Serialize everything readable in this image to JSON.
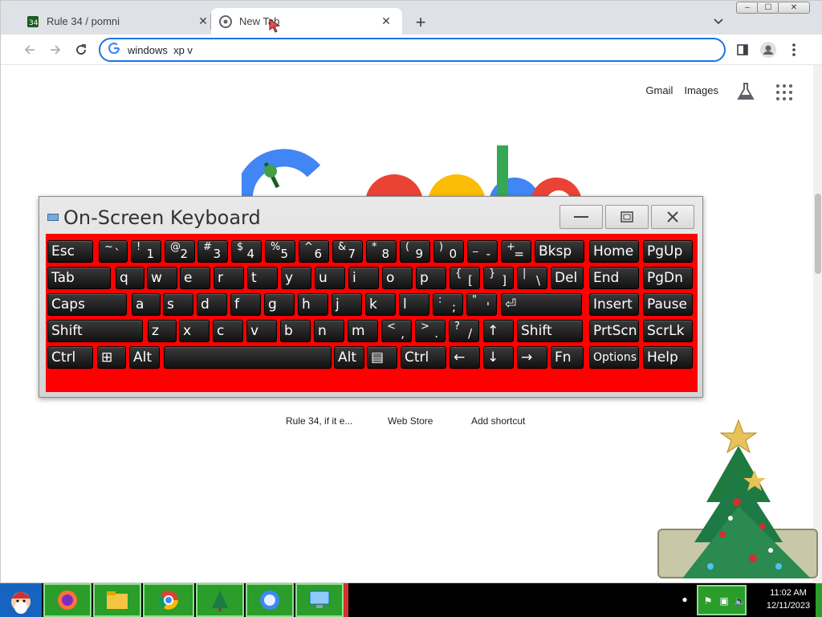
{
  "browser": {
    "tabs": [
      {
        "title": "Rule 34 / pomni",
        "active": false
      },
      {
        "title": "New Tab",
        "active": true
      }
    ],
    "omnibox_text": "windows  xp v",
    "window_controls": [
      "–",
      "☐",
      "✕"
    ]
  },
  "ntp": {
    "links": {
      "gmail": "Gmail",
      "images": "Images"
    },
    "doodle_text": "Google",
    "shortcuts": [
      "Rule 34, if it e...",
      "Web Store",
      "Add shortcut"
    ]
  },
  "osk": {
    "title": "On-Screen Keyboard",
    "rows": [
      [
        {
          "main": "Esc"
        },
        {
          "shift": "~",
          "base": "`"
        },
        {
          "shift": "!",
          "base": "1"
        },
        {
          "shift": "@",
          "base": "2"
        },
        {
          "shift": "#",
          "base": "3"
        },
        {
          "shift": "$",
          "base": "4"
        },
        {
          "shift": "%",
          "base": "5"
        },
        {
          "shift": "^",
          "base": "6"
        },
        {
          "shift": "&",
          "base": "7"
        },
        {
          "shift": "*",
          "base": "8"
        },
        {
          "shift": "(",
          "base": "9"
        },
        {
          "shift": ")",
          "base": "0"
        },
        {
          "shift": "_",
          "base": "-"
        },
        {
          "shift": "+",
          "base": "="
        },
        {
          "main": "Bksp"
        },
        {
          "main": "Home"
        },
        {
          "main": "PgUp"
        }
      ],
      [
        {
          "main": "Tab"
        },
        {
          "main": "q"
        },
        {
          "main": "w"
        },
        {
          "main": "e"
        },
        {
          "main": "r"
        },
        {
          "main": "t"
        },
        {
          "main": "y"
        },
        {
          "main": "u"
        },
        {
          "main": "i"
        },
        {
          "main": "o"
        },
        {
          "main": "p"
        },
        {
          "shift": "{",
          "base": "["
        },
        {
          "shift": "}",
          "base": "]"
        },
        {
          "shift": "|",
          "base": "\\"
        },
        {
          "main": "Del"
        },
        {
          "main": "End"
        },
        {
          "main": "PgDn"
        }
      ],
      [
        {
          "main": "Caps"
        },
        {
          "main": "a"
        },
        {
          "main": "s"
        },
        {
          "main": "d"
        },
        {
          "main": "f"
        },
        {
          "main": "g"
        },
        {
          "main": "h"
        },
        {
          "main": "j"
        },
        {
          "main": "k"
        },
        {
          "main": "l"
        },
        {
          "shift": ":",
          "base": ";"
        },
        {
          "shift": "\"",
          "base": "'"
        },
        {
          "main": "⏎"
        },
        {
          "main": "Insert"
        },
        {
          "main": "Pause"
        }
      ],
      [
        {
          "main": "Shift"
        },
        {
          "main": "z"
        },
        {
          "main": "x"
        },
        {
          "main": "c"
        },
        {
          "main": "v"
        },
        {
          "main": "b"
        },
        {
          "main": "n"
        },
        {
          "main": "m"
        },
        {
          "shift": "<",
          "base": ","
        },
        {
          "shift": ">",
          "base": "."
        },
        {
          "shift": "?",
          "base": "/"
        },
        {
          "main": "↑"
        },
        {
          "main": "Shift"
        },
        {
          "main": "PrtScn"
        },
        {
          "main": "ScrLk"
        }
      ],
      [
        {
          "main": "Ctrl"
        },
        {
          "main": "⊞"
        },
        {
          "main": "Alt"
        },
        {
          "main": ""
        },
        {
          "main": "Alt"
        },
        {
          "main": "▤"
        },
        {
          "main": "Ctrl"
        },
        {
          "main": "←"
        },
        {
          "main": "↓"
        },
        {
          "main": "→"
        },
        {
          "main": "Fn"
        },
        {
          "main": "Options",
          "small": true
        },
        {
          "main": "Help"
        }
      ]
    ]
  },
  "taskbar": {
    "clock_time": "11:02 AM",
    "clock_date": "12/11/2023",
    "apps": [
      "santa-start",
      "firefox",
      "file-explorer",
      "chrome",
      "christmas-tree",
      "messenger",
      "computer"
    ]
  },
  "colors": {
    "osk_background": "#ff0000",
    "taskbar_item": "#2a9d2a",
    "omnibox_focus": "#1a73e8"
  }
}
